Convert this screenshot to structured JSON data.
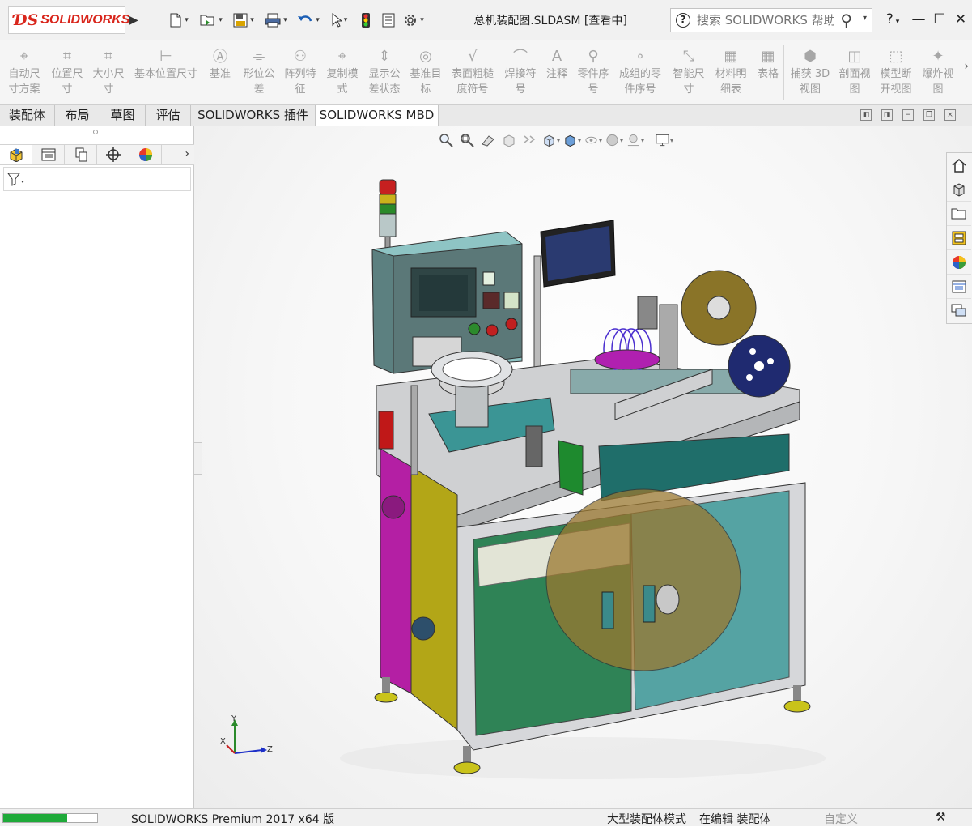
{
  "app": {
    "brand": "SOLIDWORKS",
    "document_title": "总机装配图.SLDASM [查看中]"
  },
  "search": {
    "placeholder": "搜索 SOLIDWORKS 帮助"
  },
  "window_controls": {
    "help": "?",
    "minimize": "—",
    "maximize": "☐",
    "close": "✕"
  },
  "ribbon": {
    "items": [
      {
        "label": "自动尺\n寸方案",
        "icon": "auto-dimension-icon"
      },
      {
        "label": "位置尺\n寸",
        "icon": "location-dimension-icon"
      },
      {
        "label": "大小尺\n寸",
        "icon": "size-dimension-icon"
      },
      {
        "label": "基本位置尺寸",
        "icon": "basic-location-dimension-icon"
      },
      {
        "label": "基准",
        "icon": "datum-icon"
      },
      {
        "label": "形位公\n差",
        "icon": "geometric-tolerance-icon"
      },
      {
        "label": "阵列特\n征",
        "icon": "pattern-feature-icon"
      },
      {
        "label": "复制模\n式",
        "icon": "copy-scheme-icon"
      },
      {
        "label": "显示公\n差状态",
        "icon": "show-tolerance-status-icon"
      },
      {
        "label": "基准目\n标",
        "icon": "datum-target-icon"
      },
      {
        "label": "表面粗糙\n度符号",
        "icon": "surface-finish-icon"
      },
      {
        "label": "焊接符\n号",
        "icon": "weld-symbol-icon"
      },
      {
        "label": "注释",
        "icon": "note-icon"
      },
      {
        "label": "零件序\n号",
        "icon": "balloon-icon"
      },
      {
        "label": "成组的零\n件序号",
        "icon": "stacked-balloon-icon"
      },
      {
        "label": "智能尺\n寸",
        "icon": "smart-dimension-icon"
      },
      {
        "label": "材料明\n细表",
        "icon": "bill-of-materials-icon"
      },
      {
        "label": "表格",
        "icon": "table-icon"
      },
      {
        "label": "捕获 3D\n视图",
        "icon": "capture-3d-view-icon"
      },
      {
        "label": "剖面视\n图",
        "icon": "section-view-icon"
      },
      {
        "label": "模型断\n开视图",
        "icon": "model-break-view-icon"
      },
      {
        "label": "爆炸视\n图",
        "icon": "exploded-view-icon"
      }
    ]
  },
  "tabs": [
    "装配体",
    "布局",
    "草图",
    "评估",
    "SOLIDWORKS 插件",
    "SOLIDWORKS MBD"
  ],
  "active_tab": "SOLIDWORKS MBD",
  "triad": {
    "x": "X",
    "y": "Y",
    "z": "Z"
  },
  "statusbar": {
    "product": "SOLIDWORKS Premium 2017 x64 版",
    "mode": "大型装配体模式",
    "editing": "在编辑 装配体",
    "custom": "自定义",
    "progress": 0.68
  },
  "colors": {
    "accent_red": "#d9261c",
    "progress_green": "#1faa3a",
    "machine_teal": "#1f6e6a",
    "door_magenta": "#b41fa4",
    "door_olive": "#b3a617"
  }
}
